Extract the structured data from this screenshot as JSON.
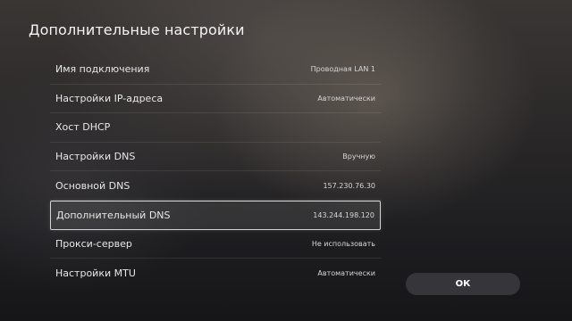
{
  "page": {
    "title": "Дополнительные настройки"
  },
  "settings": [
    {
      "label": "Имя подключения",
      "value": "Проводная LAN 1",
      "selected": false
    },
    {
      "label": "Настройки IP-адреса",
      "value": "Автоматически",
      "selected": false
    },
    {
      "label": "Хост DHCP",
      "value": "",
      "selected": false
    },
    {
      "label": "Настройки DNS",
      "value": "Вручную",
      "selected": false
    },
    {
      "label": "Основной DNS",
      "value": "157.230.76.30",
      "selected": false
    },
    {
      "label": "Дополнительный DNS",
      "value": "143.244.198.120",
      "selected": true
    },
    {
      "label": "Прокси-сервер",
      "value": "Не использовать",
      "selected": false
    },
    {
      "label": "Настройки MTU",
      "value": "Автоматически",
      "selected": false
    }
  ],
  "actions": {
    "ok_label": "ОК"
  }
}
